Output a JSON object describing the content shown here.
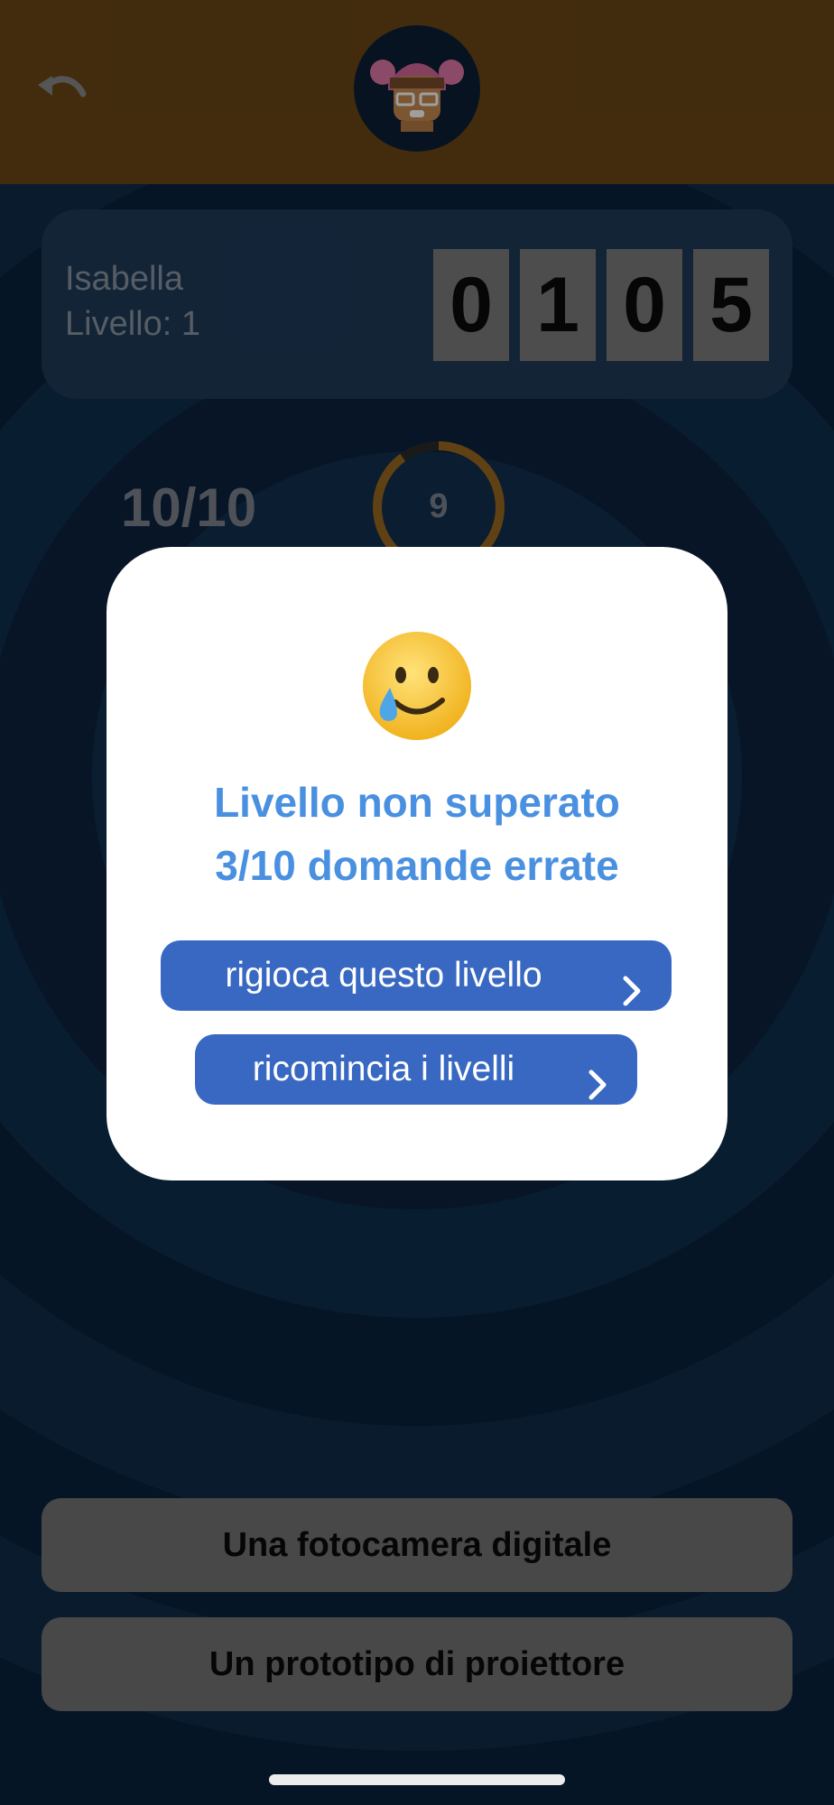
{
  "header": {
    "back_icon": "undo-arrow-icon",
    "avatar_icon": "player-avatar-icon",
    "colors": {
      "background": "#6b4716"
    }
  },
  "player": {
    "name": "Isabella",
    "level": "Livello: 1",
    "score_digits": [
      "0",
      "1",
      "0",
      "5"
    ]
  },
  "quiz": {
    "progress": "10/10",
    "timer_value": "9",
    "timer_fraction": 0.9,
    "answers": [
      "Una fotocamera digitale",
      "Un prototipo di proiettore"
    ]
  },
  "modal": {
    "emoji_icon": "smiling-face-with-tear-icon",
    "title": "Livello non superato",
    "subtitle": "3/10 domande errate",
    "replay_label": "rigioca questo livello",
    "restart_label": "ricomincia i livelli",
    "chevron_icon": "chevron-right-icon",
    "colors": {
      "title": "#4a90e0",
      "button": "#3868c2"
    }
  }
}
